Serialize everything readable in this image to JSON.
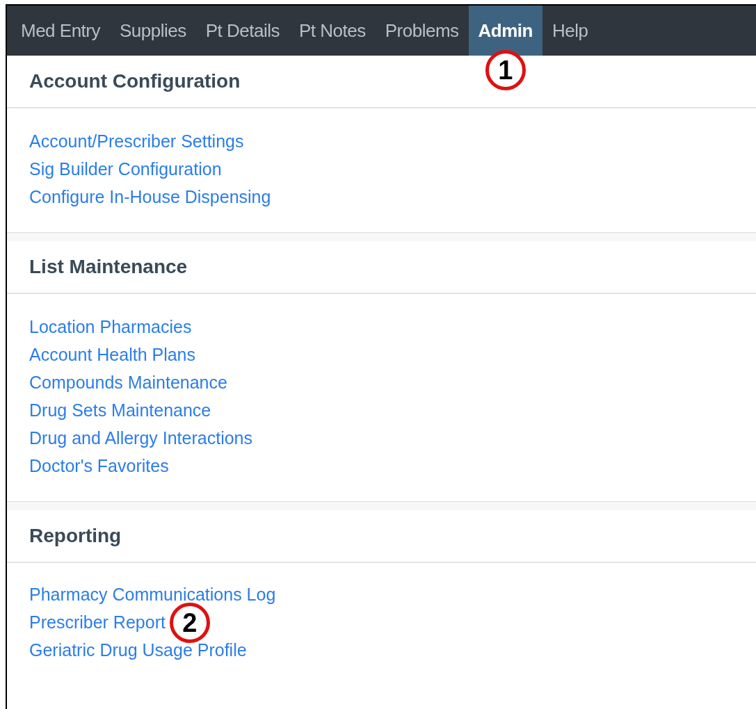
{
  "nav": {
    "items": [
      {
        "label": "Med Entry",
        "selected": false
      },
      {
        "label": "Supplies",
        "selected": false
      },
      {
        "label": "Pt Details",
        "selected": false
      },
      {
        "label": "Pt Notes",
        "selected": false
      },
      {
        "label": "Problems",
        "selected": false
      },
      {
        "label": "Admin",
        "selected": true,
        "callout": "1"
      },
      {
        "label": "Help",
        "selected": false
      }
    ]
  },
  "sections": [
    {
      "title": "Account Configuration",
      "links": [
        {
          "label": "Account/Prescriber Settings"
        },
        {
          "label": "Sig Builder Configuration"
        },
        {
          "label": "Configure In-House Dispensing"
        }
      ]
    },
    {
      "title": "List Maintenance",
      "links": [
        {
          "label": "Location Pharmacies"
        },
        {
          "label": "Account Health Plans"
        },
        {
          "label": "Compounds Maintenance"
        },
        {
          "label": "Drug Sets Maintenance"
        },
        {
          "label": "Drug and Allergy Interactions"
        },
        {
          "label": "Doctor's Favorites"
        }
      ]
    },
    {
      "title": "Reporting",
      "links": [
        {
          "label": "Pharmacy Communications Log"
        },
        {
          "label": "Prescriber Report",
          "callout": "2"
        },
        {
          "label": "Geriatric Drug Usage Profile"
        }
      ]
    }
  ]
}
